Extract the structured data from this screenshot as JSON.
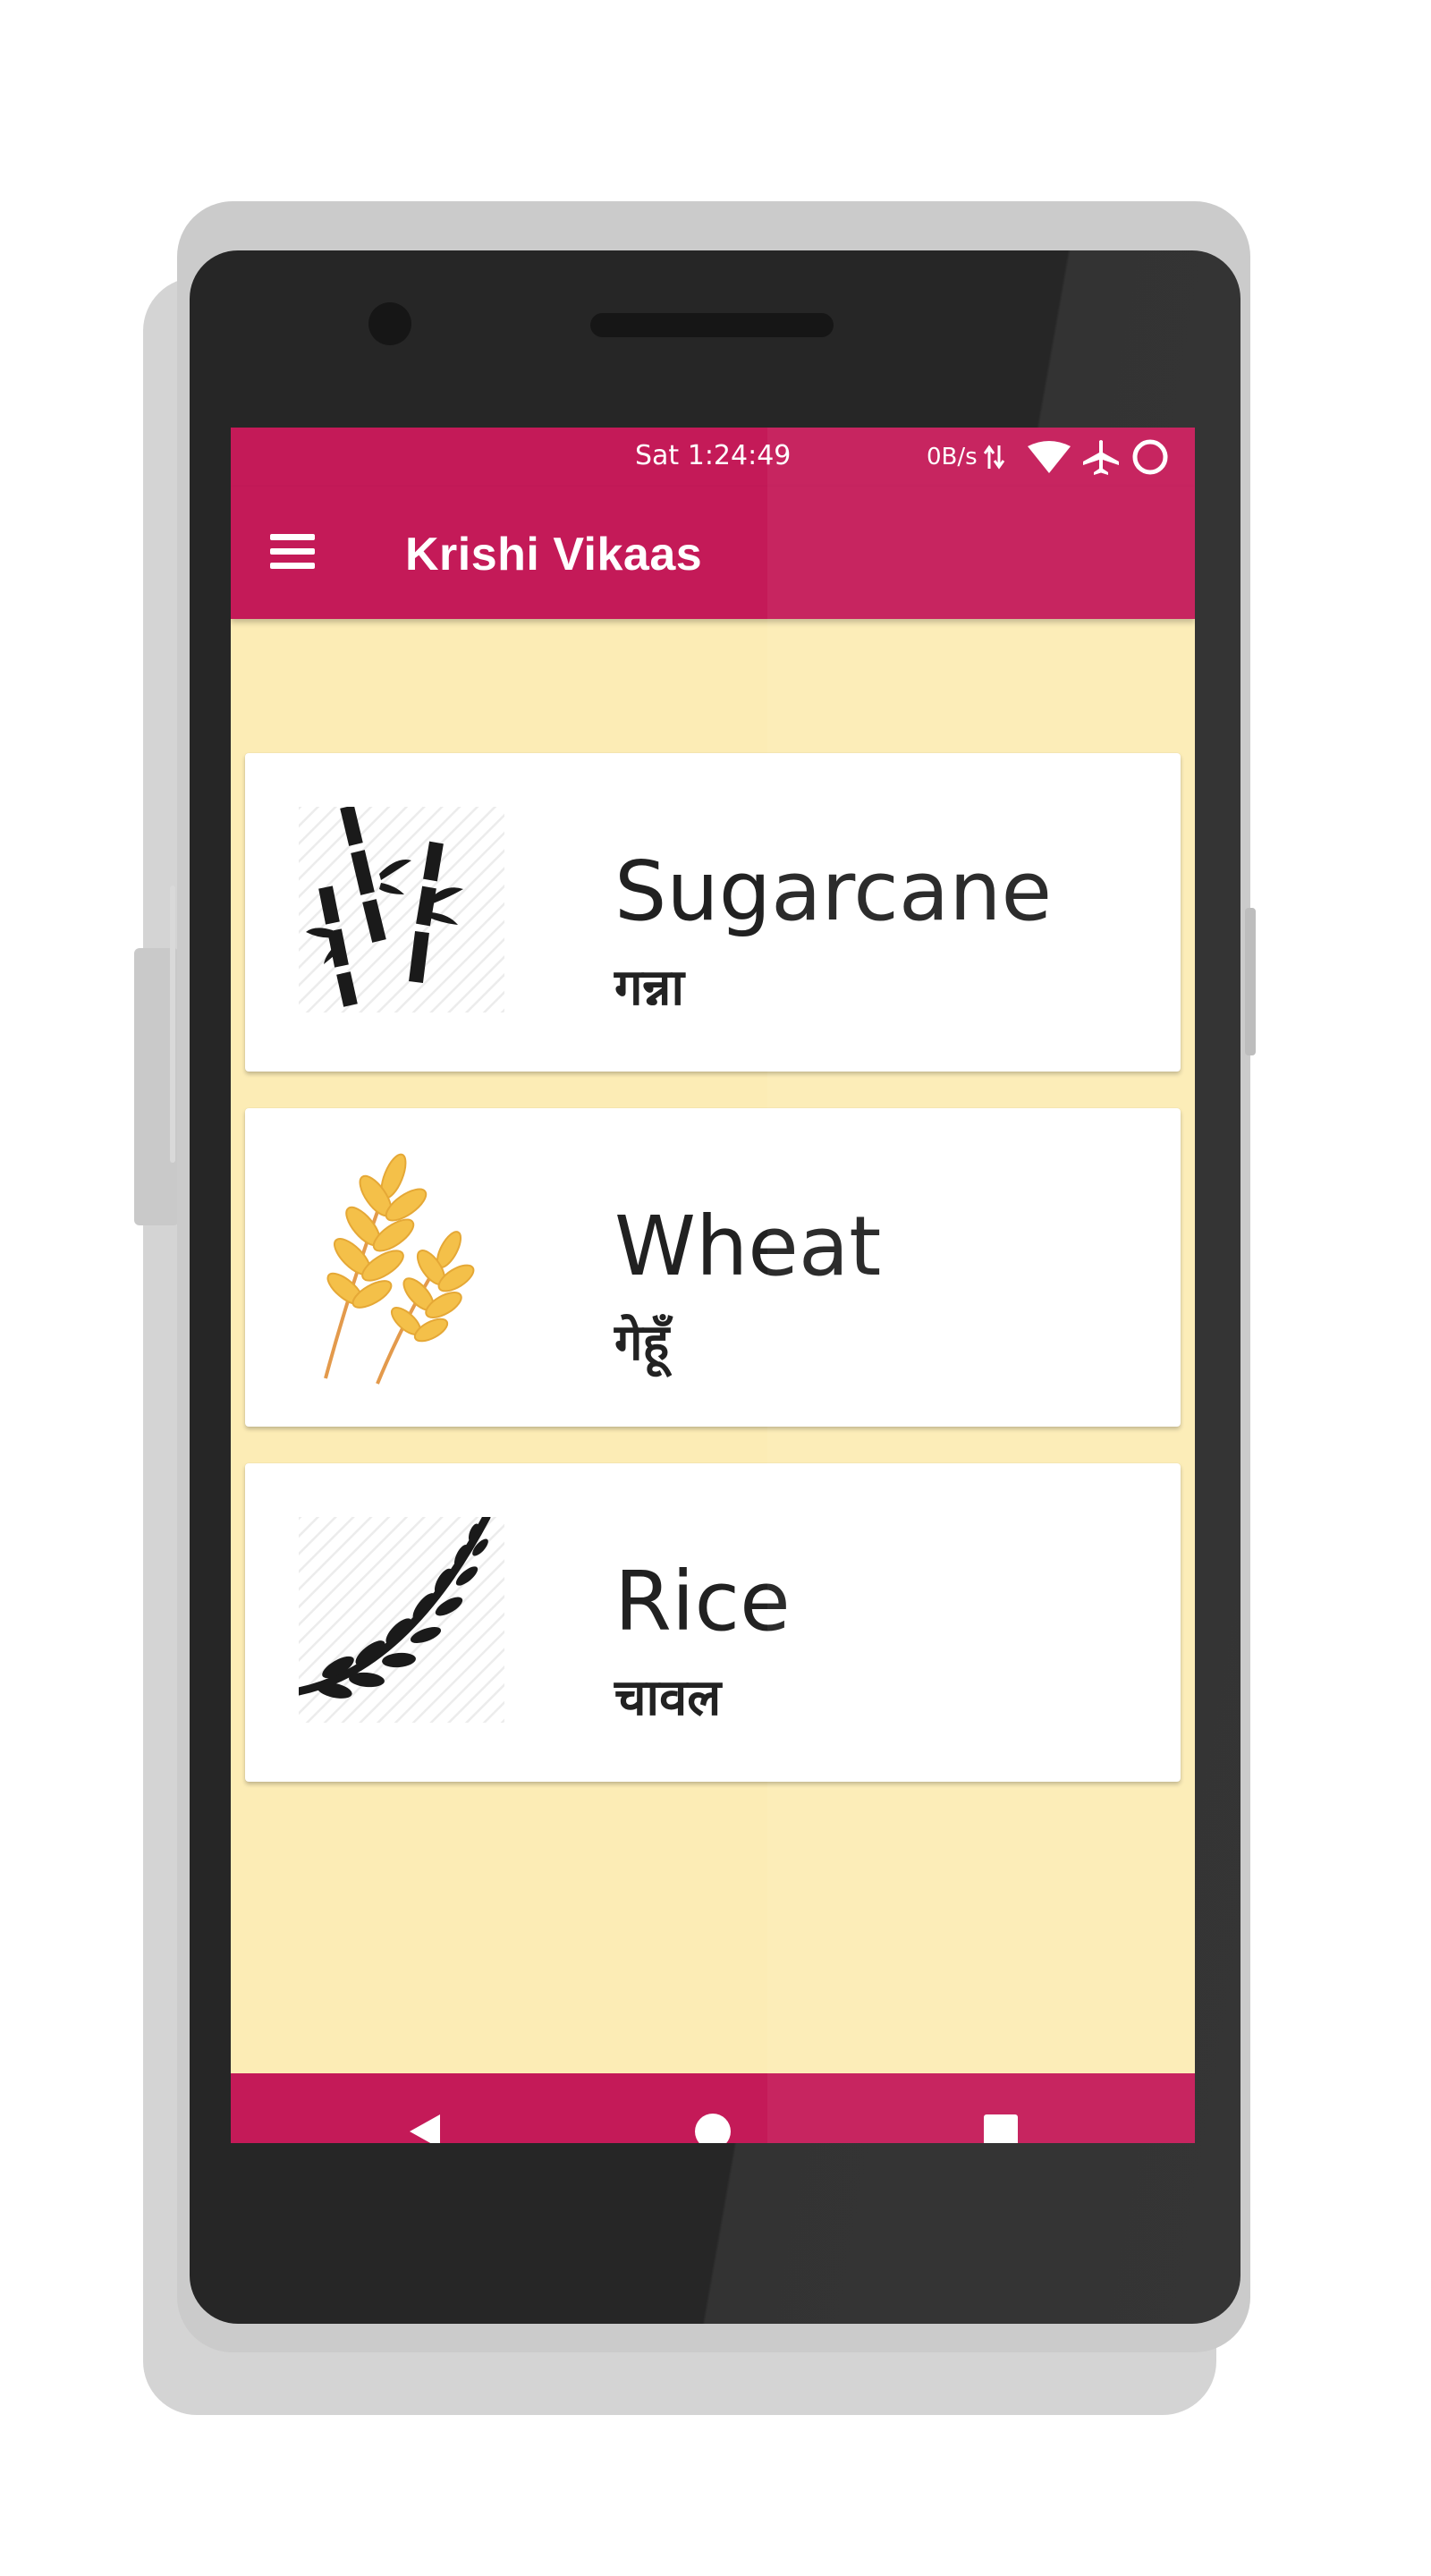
{
  "status_bar": {
    "time": "Sat 1:24:49",
    "speed": "0B/s",
    "icons": [
      "data-arrows-icon",
      "wifi-icon",
      "airplane-icon",
      "circle-icon"
    ]
  },
  "app_bar": {
    "title": "Krishi Vikaas",
    "menu_icon": "hamburger-menu-icon"
  },
  "crops": [
    {
      "name": "Sugarcane",
      "local_name": "गन्ना",
      "icon": "sugarcane-icon"
    },
    {
      "name": "Wheat",
      "local_name": "गेहूँ",
      "icon": "wheat-icon"
    },
    {
      "name": "Rice",
      "local_name": "चावल",
      "icon": "rice-icon"
    }
  ],
  "nav_bar": {
    "buttons": [
      "back-icon",
      "home-icon",
      "recents-icon"
    ]
  },
  "colors": {
    "primary": "#c41a58",
    "background": "#fcecb5",
    "card": "#ffffff",
    "text": "#212121",
    "wheat": "#f4c049"
  }
}
